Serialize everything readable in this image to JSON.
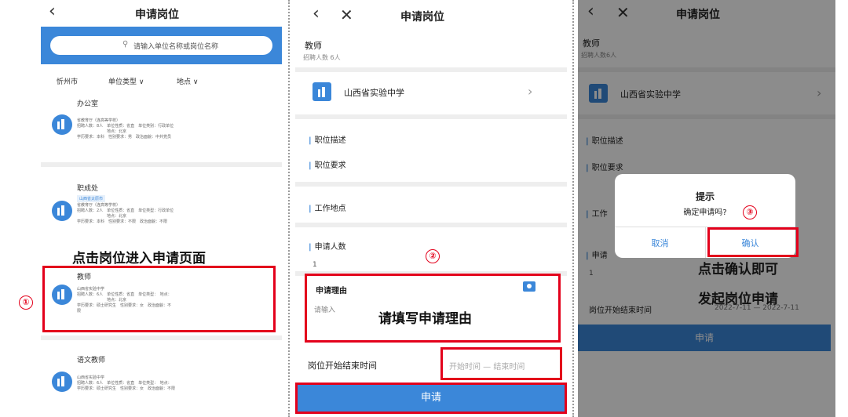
{
  "panel1": {
    "title": "申请岗位",
    "search_placeholder": "请输入单位名称或岗位名称",
    "filters": {
      "city": "忻州市",
      "unit_type": "单位类型",
      "location": "地点"
    },
    "cards": [
      {
        "title": "办公室",
        "lines": [
          "省教育厅（连高等学校）",
          "招聘人数：8人　单位性质：省直　单位类别：行政单位",
          "地点：北京",
          "学历要求：本科　性别要求：男　政治面貌：中共党员"
        ]
      },
      {
        "title": "职成处",
        "tag": "山西省太原市",
        "lines": [
          "省教育厅（连高等学校）",
          "招聘人数：2人　单位性质：省直　单位类型：行政单位",
          "地点：北京",
          "学历要求：本科　性别要求：不限　政治面貌：不限"
        ]
      },
      {
        "title": "教师",
        "lines": [
          "山西省实验中学",
          "招聘人数：6人　单位性质：省直　单位类型：　地点：",
          "地点：北京",
          "学历要求：硕士研究生　性别要求：女　政治面貌：不",
          "限"
        ]
      },
      {
        "title": "语文教师",
        "lines": [
          "山西省实验中学",
          "招聘人数：6人　单位性质：省直　单位类型：　地点：",
          "学历要求：硕士研究生　性别要求：女　政治面貌：不限"
        ]
      }
    ],
    "annotation": "点击岗位进入申请页面",
    "step": "①"
  },
  "panel2": {
    "title": "申请岗位",
    "job_title": "教师",
    "headcount": "招聘人数 6人",
    "school": "山西省实验中学",
    "sections": [
      "职位描述",
      "职位要求",
      "工作地点",
      "申请人数"
    ],
    "applicant_count": "1",
    "reason_label": "申请理由",
    "reason_placeholder": "请输入",
    "annotation": "请填写申请理由",
    "step": "②",
    "time_label": "岗位开始结束时间",
    "time_placeholder": "开始时间 — 结束时间",
    "submit": "申请"
  },
  "panel3": {
    "title": "申请岗位",
    "job_title": "教师",
    "headcount": "招聘人数6人",
    "school": "山西省实验中学",
    "sections": [
      "职位描述",
      "职位要求",
      "工作",
      "申请"
    ],
    "applicant_count": "1",
    "time_label": "岗位开始结束时间",
    "time_value": "2022-7-11 — 2022-7-11",
    "submit": "申请",
    "dialog": {
      "title": "提示",
      "message": "确定申请吗?",
      "cancel": "取消",
      "confirm": "确认"
    },
    "step": "③",
    "annotation_line1": "点击确认即可",
    "annotation_line2": "发起岗位申请"
  },
  "colors": {
    "accent": "#3b87d9",
    "highlight": "#e3001b",
    "submit": "#3b87d9"
  }
}
